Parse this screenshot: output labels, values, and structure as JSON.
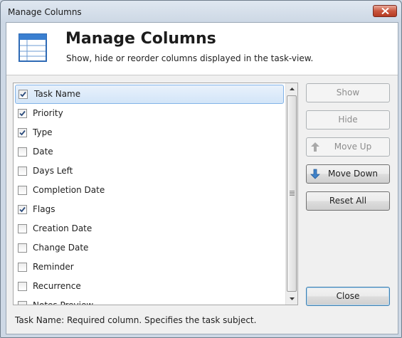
{
  "window": {
    "title": "Manage Columns"
  },
  "header": {
    "title": "Manage Columns",
    "subtitle": "Show, hide or reorder columns displayed in the task-view.",
    "icon": "table-icon"
  },
  "columns": [
    {
      "label": "Task Name",
      "checked": true,
      "selected": true
    },
    {
      "label": "Priority",
      "checked": true
    },
    {
      "label": "Type",
      "checked": true
    },
    {
      "label": "Date",
      "checked": false
    },
    {
      "label": "Days Left",
      "checked": false
    },
    {
      "label": "Completion Date",
      "checked": false
    },
    {
      "label": "Flags",
      "checked": true
    },
    {
      "label": "Creation Date",
      "checked": false
    },
    {
      "label": "Change Date",
      "checked": false
    },
    {
      "label": "Reminder",
      "checked": false
    },
    {
      "label": "Recurrence",
      "checked": false
    },
    {
      "label": "Notes Preview",
      "checked": false
    }
  ],
  "buttons": {
    "show": "Show",
    "hide": "Hide",
    "move_up": "Move Up",
    "move_down": "Move Down",
    "reset_all": "Reset All",
    "close": "Close"
  },
  "status": "Task Name: Required column. Specifies the task subject.",
  "colors": {
    "selection_border": "#82b3e8",
    "default_button_border": "#3c7fb1",
    "title_close": "#c9553d"
  }
}
